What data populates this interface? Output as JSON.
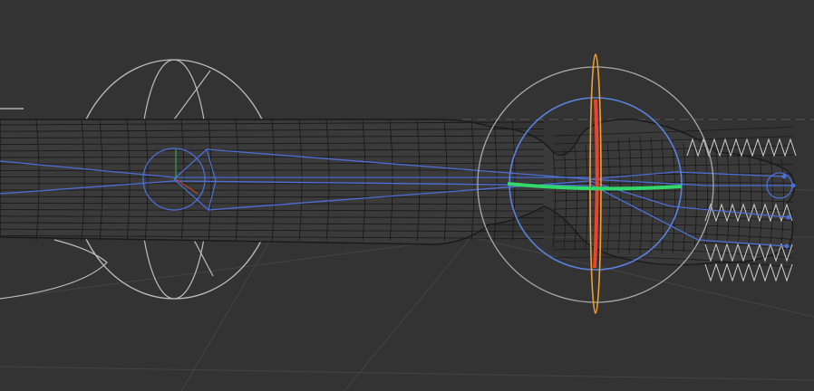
{
  "viewport": {
    "background": "#333333",
    "grid_color": "#444444",
    "mesh_color": "#1a1a1a",
    "mesh_fill": "#3a3a3a",
    "bone_color": "#4d6fd6",
    "control_ring_color": "#bdbdbd",
    "gizmo_x_color": "#e8442e",
    "gizmo_y_color": "#32d86a",
    "gizmo_z_color": "#f0a030",
    "gizmo_view_color": "#5a82e0",
    "gizmo_outer_color": "#a8a8a8"
  },
  "icons": {
    "rotate_gizmo": "rotate-gizmo-icon",
    "shoulder_control": "shoulder-control-icon",
    "elbow_joint": "elbow-joint-icon",
    "hand_bones": "hand-bones-icon"
  }
}
